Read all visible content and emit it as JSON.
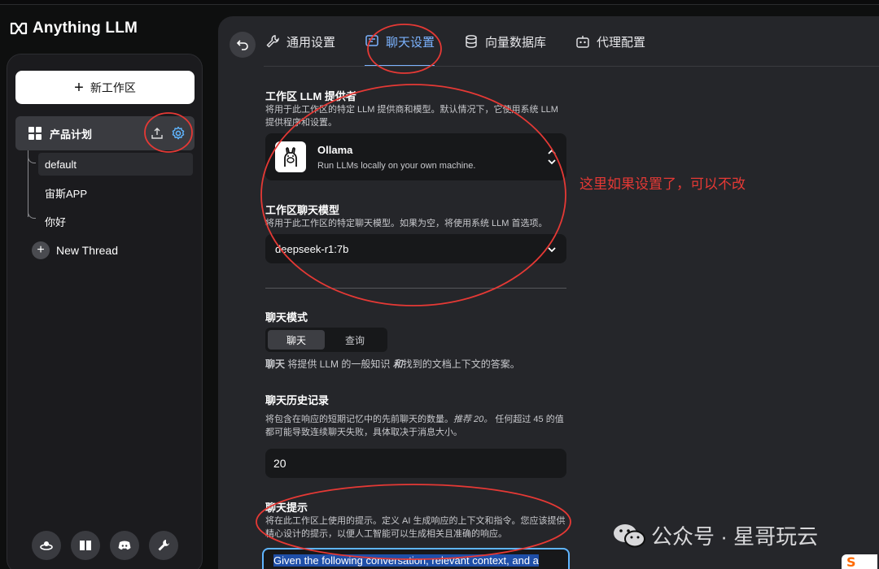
{
  "app": {
    "title": "Anything LLM"
  },
  "sidebar": {
    "new_workspace_label": "新工作区",
    "workspace": {
      "name": "产品计划"
    },
    "threads": [
      {
        "label": "default",
        "active": true
      },
      {
        "label": "宙斯APP",
        "active": false
      },
      {
        "label": "你好",
        "active": false
      }
    ],
    "new_thread_label": "New Thread",
    "footer_icons": [
      "community-hub-icon",
      "docs-book-icon",
      "discord-icon",
      "wrench-icon"
    ]
  },
  "tabs": [
    {
      "label": "通用设置",
      "icon": "wrench-icon",
      "active": false
    },
    {
      "label": "聊天设置",
      "icon": "chat-icon",
      "active": true
    },
    {
      "label": "向量数据库",
      "icon": "database-icon",
      "active": false
    },
    {
      "label": "代理配置",
      "icon": "robot-icon",
      "active": false
    }
  ],
  "settings": {
    "provider": {
      "title": "工作区 LLM 提供者",
      "desc": "将用于此工作区的特定 LLM 提供商和模型。默认情况下，它使用系统 LLM 提供程序和设置。",
      "name": "Ollama",
      "subtitle": "Run LLMs locally on your own machine."
    },
    "model": {
      "title": "工作区聊天模型",
      "desc": "将用于此工作区的特定聊天模型。如果为空，将使用系统 LLM 首选项。",
      "value": "deepseek-r1:7b"
    },
    "chat_mode": {
      "title": "聊天模式",
      "options": [
        "聊天",
        "查询"
      ],
      "selected": "聊天",
      "desc_prefix": "聊天",
      "desc_middle": " 将提供 LLM 的一般知识 ",
      "desc_emph": "和",
      "desc_suffix": "找到的文档上下文的答案。"
    },
    "history": {
      "title": "聊天历史记录",
      "desc_a": "将包含在响应的短期记忆中的先前聊天的数量。",
      "desc_emph": "推荐 20。",
      "desc_b": " 任何超过 45 的值都可能导致连续聊天失败，具体取决于消息大小。",
      "value": "20"
    },
    "prompt": {
      "title": "聊天提示",
      "desc": "将在此工作区上使用的提示。定义 AI 生成响应的上下文和指令。您应该提供精心设计的提示，以便人工智能可以生成相关且准确的响应。",
      "value": "Given the following conversation, relevant context, and a"
    }
  },
  "annotation": {
    "text": "这里如果设置了，可以不改",
    "color": "#e53935"
  },
  "watermark": {
    "text": "公众号 · 星哥玩云"
  },
  "colors": {
    "accent": "#7cb3ff",
    "annotation_red": "#e53935"
  }
}
